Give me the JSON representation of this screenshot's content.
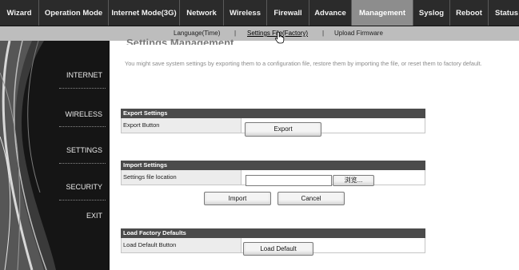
{
  "topnav": {
    "tabs": [
      {
        "label": "Wizard"
      },
      {
        "label": "Operation Mode"
      },
      {
        "label": "Internet Mode(3G)"
      },
      {
        "label": "Network"
      },
      {
        "label": "Wireless"
      },
      {
        "label": "Firewall"
      },
      {
        "label": "Advance"
      },
      {
        "label": "Management",
        "active": true
      },
      {
        "label": "Syslog"
      },
      {
        "label": "Reboot"
      },
      {
        "label": "Status"
      }
    ]
  },
  "subnav": {
    "items": [
      "Language(Time)",
      "Settings File(Factory)",
      "Upload Firmware"
    ],
    "separator": "|"
  },
  "sidebar": {
    "items": [
      "INTERNET",
      "WIRELESS",
      "SETTINGS",
      "SECURITY",
      "EXIT"
    ]
  },
  "main": {
    "heading": "Settings Management",
    "description": "You might save system settings by exporting them to a configuration file, restore them by importing the file, or reset them to factory default.",
    "export": {
      "title": "Export Settings",
      "row_label": "Export Button",
      "button": "Export"
    },
    "import": {
      "title": "Import Settings",
      "row_label": "Settings file location",
      "file_value": "",
      "browse_button": "浏览...",
      "import_button": "Import",
      "cancel_button": "Cancel"
    },
    "factory": {
      "title": "Load Factory Defaults",
      "row_label": "Load Default Button",
      "button": "Load Default"
    }
  },
  "colors": {
    "topnav_bg": "#2b2b2b",
    "topnav_active": "#8d8d8d",
    "subnav_bg": "#bdbdbd",
    "sidebar_bg": "#151515",
    "section_header": "#4b4b4b"
  },
  "icons": {
    "cursor": "hand-pointer-icon"
  }
}
